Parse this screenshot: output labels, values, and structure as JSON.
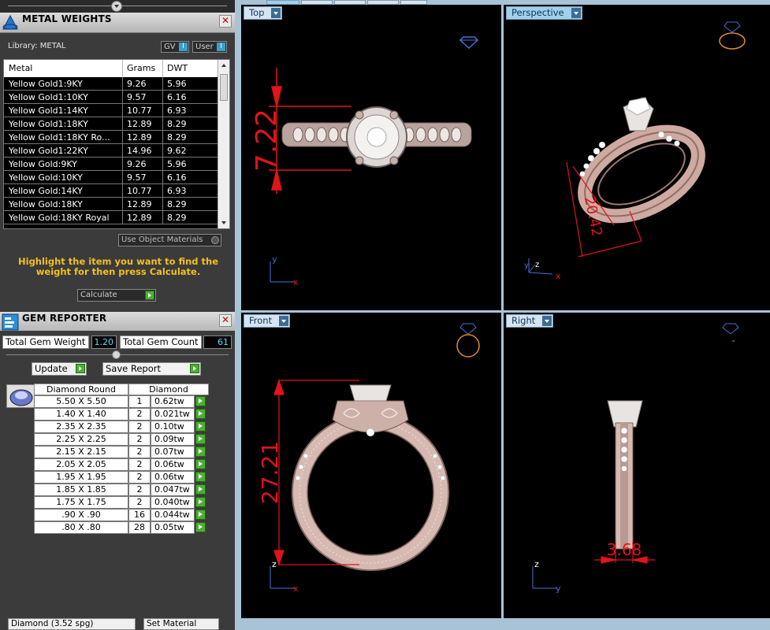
{
  "metal_weights": {
    "title": "METAL WEIGHTS",
    "library_label": "Library: METAL",
    "gv_label": "GV",
    "user_label": "User",
    "columns": [
      "Metal",
      "Grams",
      "DWT"
    ],
    "rows": [
      {
        "metal": "Yellow Gold1:9KY",
        "grams": "9.26",
        "dwt": "5.96"
      },
      {
        "metal": "Yellow Gold1:10KY",
        "grams": "9.57",
        "dwt": "6.16"
      },
      {
        "metal": "Yellow Gold1:14KY",
        "grams": "10.77",
        "dwt": "6.93"
      },
      {
        "metal": "Yellow Gold1:18KY",
        "grams": "12.89",
        "dwt": "8.29"
      },
      {
        "metal": "Yellow Gold1:18KY Ro...",
        "grams": "12.89",
        "dwt": "8.29"
      },
      {
        "metal": "Yellow Gold1:22KY",
        "grams": "14.96",
        "dwt": "9.62"
      },
      {
        "metal": "Yellow Gold:9KY",
        "grams": "9.26",
        "dwt": "5.96"
      },
      {
        "metal": "Yellow Gold:10KY",
        "grams": "9.57",
        "dwt": "6.16"
      },
      {
        "metal": "Yellow Gold:14KY",
        "grams": "10.77",
        "dwt": "6.93"
      },
      {
        "metal": "Yellow Gold:18KY",
        "grams": "12.89",
        "dwt": "8.29"
      },
      {
        "metal": "Yellow Gold:18KY Royal",
        "grams": "12.89",
        "dwt": "8.29"
      }
    ],
    "use_object_materials": "Use Object Materials",
    "hint": "Highlight the item you want to find the weight for then press Calculate.",
    "calculate_label": "Calculate"
  },
  "gem_reporter": {
    "title": "GEM REPORTER",
    "total_weight_label": "Total Gem Weight",
    "total_weight_value": "1.20",
    "total_count_label": "Total Gem Count",
    "total_count_value": "61",
    "update_label": "Update",
    "save_report_label": "Save Report",
    "header_shape": "Diamond Round",
    "header_material": "Diamond",
    "rows": [
      {
        "size": "5.50 X 5.50",
        "count": "1",
        "weight": "0.62tw"
      },
      {
        "size": "1.40 X 1.40",
        "count": "2",
        "weight": "0.021tw"
      },
      {
        "size": "2.35 X 2.35",
        "count": "2",
        "weight": "0.10tw"
      },
      {
        "size": "2.25 X 2.25",
        "count": "2",
        "weight": "0.09tw"
      },
      {
        "size": "2.15 X 2.15",
        "count": "2",
        "weight": "0.07tw"
      },
      {
        "size": "2.05 X 2.05",
        "count": "2",
        "weight": "0.06tw"
      },
      {
        "size": "1.95 X 1.95",
        "count": "2",
        "weight": "0.06tw"
      },
      {
        "size": "1.85 X 1.85",
        "count": "2",
        "weight": "0.047tw"
      },
      {
        "size": "1.75 X 1.75",
        "count": "2",
        "weight": "0.040tw"
      },
      {
        "size": ".90 X .90",
        "count": "16",
        "weight": "0.044tw"
      },
      {
        "size": ".80 X .80",
        "count": "28",
        "weight": "0.05tw"
      }
    ]
  },
  "bottom_bar": {
    "material_select": "Diamond (3.52 spg)",
    "set_material_label": "Set Material"
  },
  "viewports": {
    "top": {
      "label": "Top",
      "dimension": "7.22",
      "axis_x": "x",
      "axis_y": "y"
    },
    "perspective": {
      "label": "Perspective",
      "dimension": "20.42",
      "axis_x": "x",
      "axis_y": "y",
      "axis_z": "z"
    },
    "front": {
      "label": "Front",
      "dimension": "27.21",
      "axis_x": "x",
      "axis_z": "z"
    },
    "right": {
      "label": "Right",
      "dimension": "3.68",
      "axis_y": "y",
      "axis_z": "z"
    }
  },
  "colors": {
    "dimension_red": "#e0141a",
    "metal_rose": "#d8b9b0",
    "axis_blue": "#4a6fd0",
    "hint_yellow": "#f2c020",
    "gem_value_cyan": "#5bd8f5"
  }
}
